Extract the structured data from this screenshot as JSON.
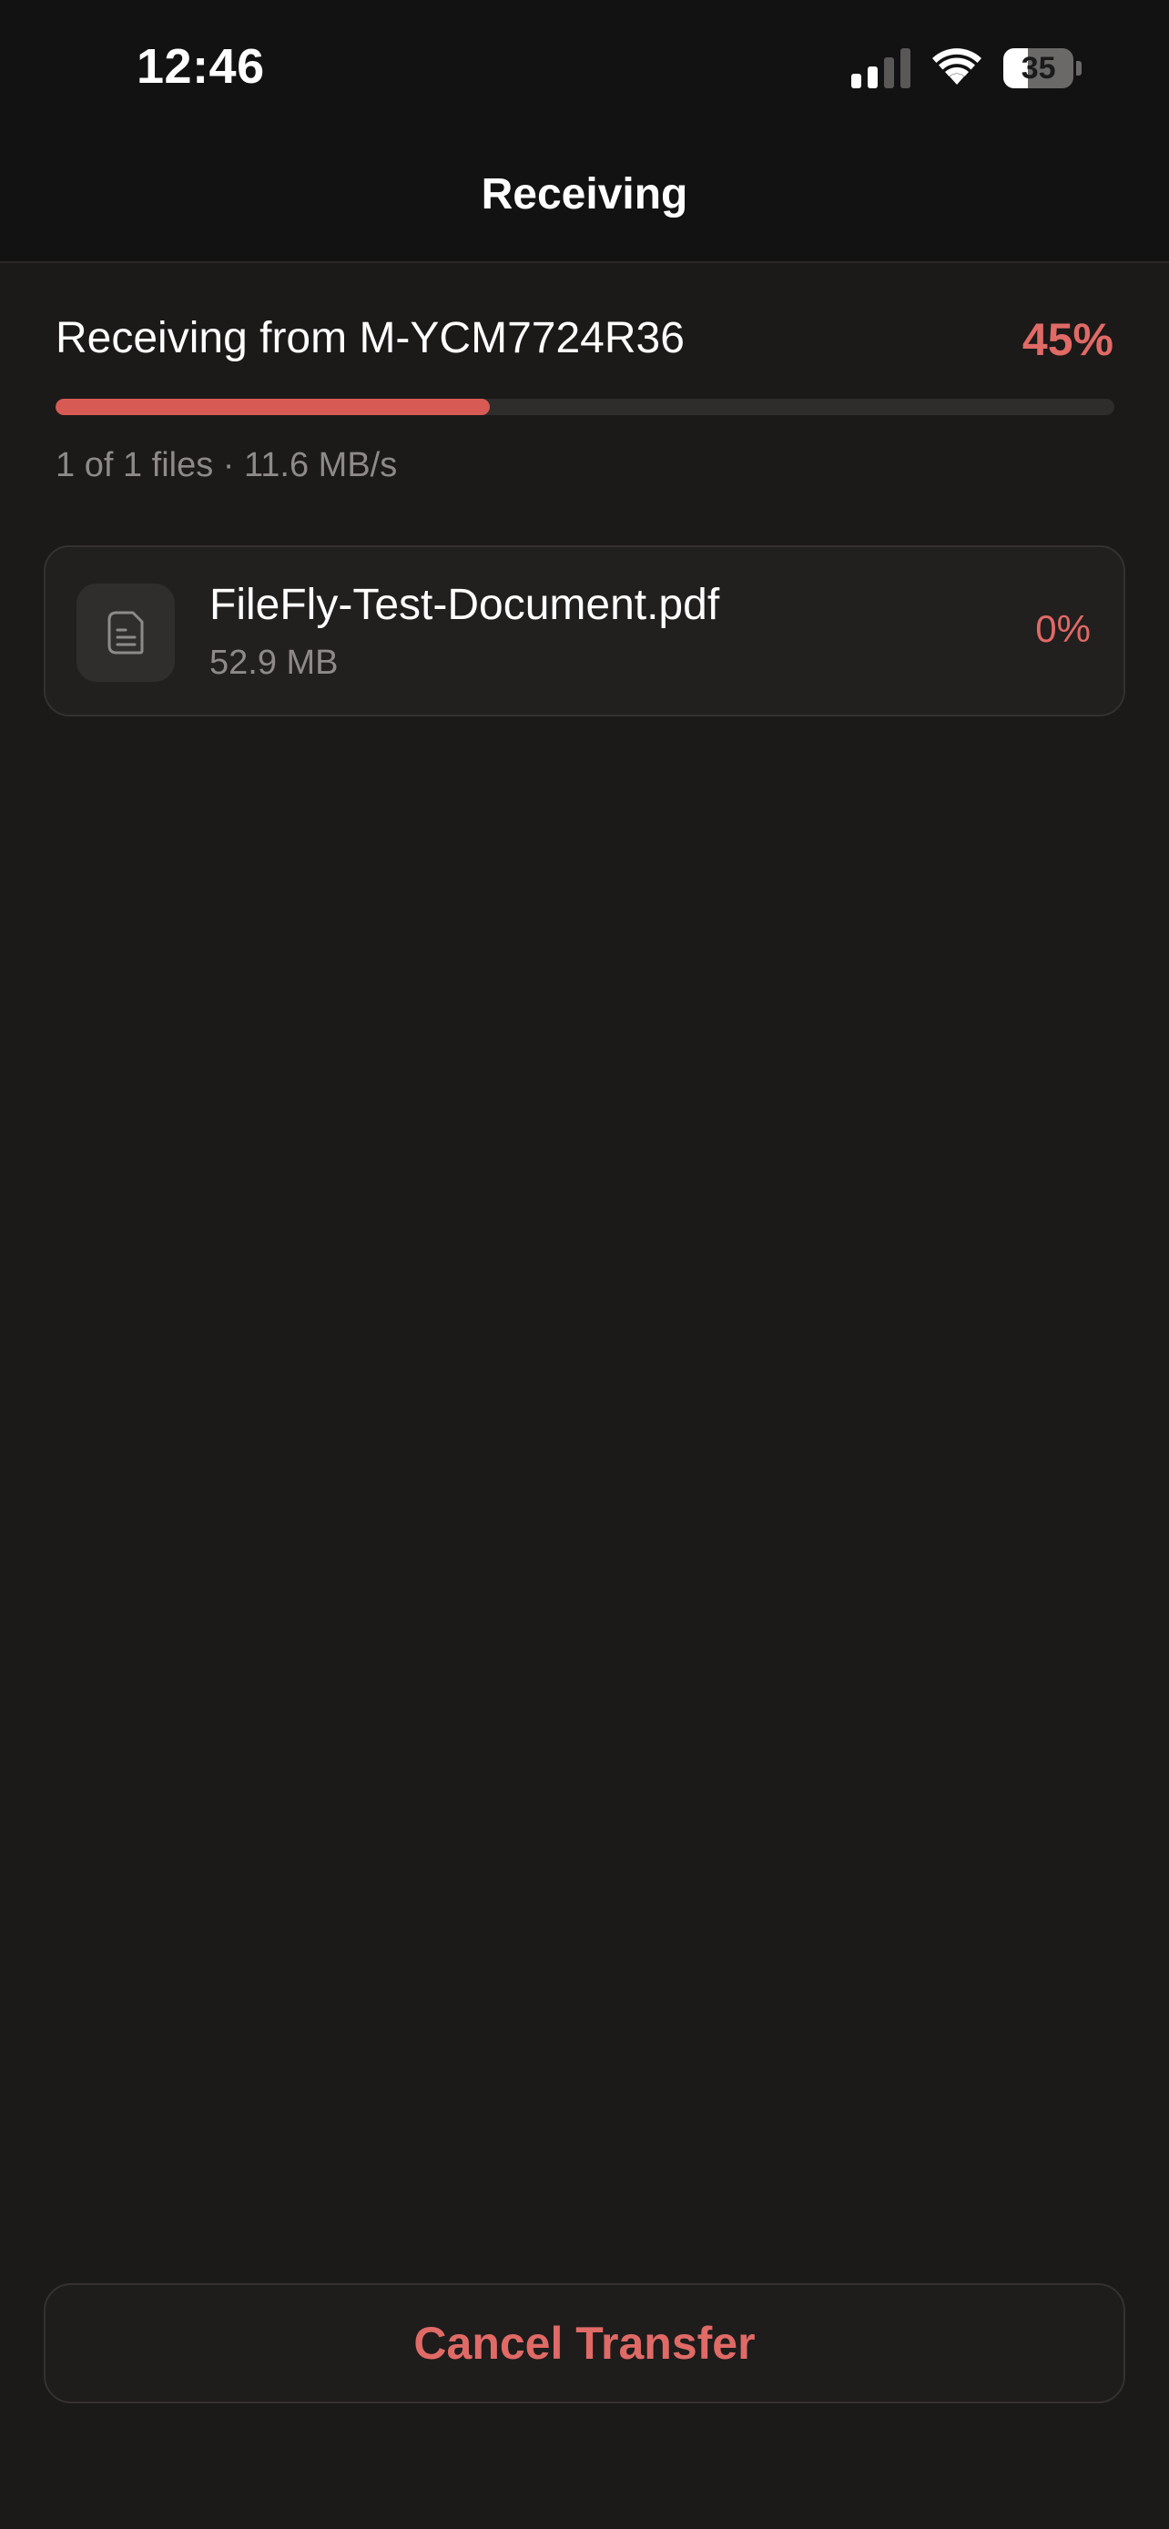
{
  "status_bar": {
    "time": "12:46",
    "battery_level": "35",
    "signal_icon": "cellular-signal-icon",
    "wifi_icon": "wifi-icon",
    "battery_icon": "battery-icon"
  },
  "nav": {
    "title": "Receiving"
  },
  "transfer": {
    "receiving_from": "Receiving from M-YCM7724R36",
    "percent_label": "45%",
    "progress_fraction": 0.41,
    "files_info": "1 of 1 files · 11.6 MB/s"
  },
  "files": [
    {
      "name": "FileFly-Test-Document.pdf",
      "size": "52.9 MB",
      "percent": "0%",
      "icon": "document-icon"
    }
  ],
  "actions": {
    "cancel_label": "Cancel Transfer"
  },
  "colors": {
    "accent": "#e06a66",
    "progress_fill": "#d85a55",
    "background": "#1c1919",
    "header_background": "#121212"
  }
}
